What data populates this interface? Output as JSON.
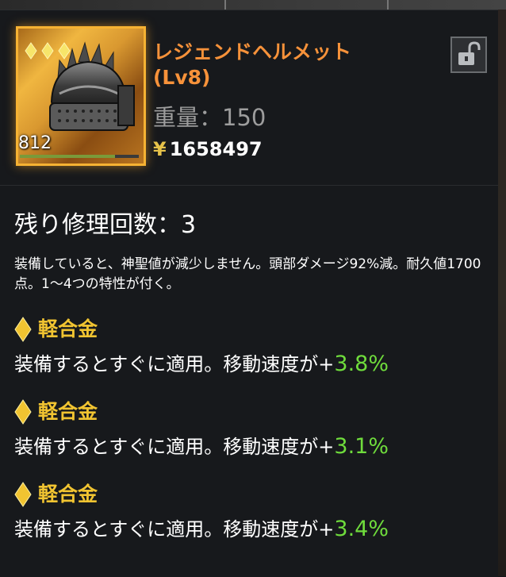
{
  "item": {
    "name": "レジェンドヘルメット",
    "level": "(Lv8)",
    "weight_label": "重量：",
    "weight_value": "150",
    "price_symbol": "¥",
    "price_value": "1658497",
    "stack_count": "812",
    "rarity_stars": 3,
    "durability_fraction": 0.8,
    "icon": "helmet-icon",
    "frame_color": "#f6b233"
  },
  "repair": {
    "label": "残り修理回数：",
    "value": "3"
  },
  "description": "装備していると、神聖値が減少しません。頭部ダメージ92%減。耐久値1700点。1～4つの特性が付く。",
  "traits": [
    {
      "name": "軽合金",
      "effect_text": "装備するとすぐに適用。移動速度が+",
      "effect_value": "3.8%"
    },
    {
      "name": "軽合金",
      "effect_text": "装備するとすぐに適用。移動速度が+",
      "effect_value": "3.1%"
    },
    {
      "name": "軽合金",
      "effect_text": "装備するとすぐに適用。移動速度が+",
      "effect_value": "3.4%"
    }
  ],
  "colors": {
    "name": "#f7923a",
    "trait_title": "#f1c431",
    "bonus_value": "#6fdc3c"
  },
  "lock_icon": "unlocked-padlock-icon"
}
